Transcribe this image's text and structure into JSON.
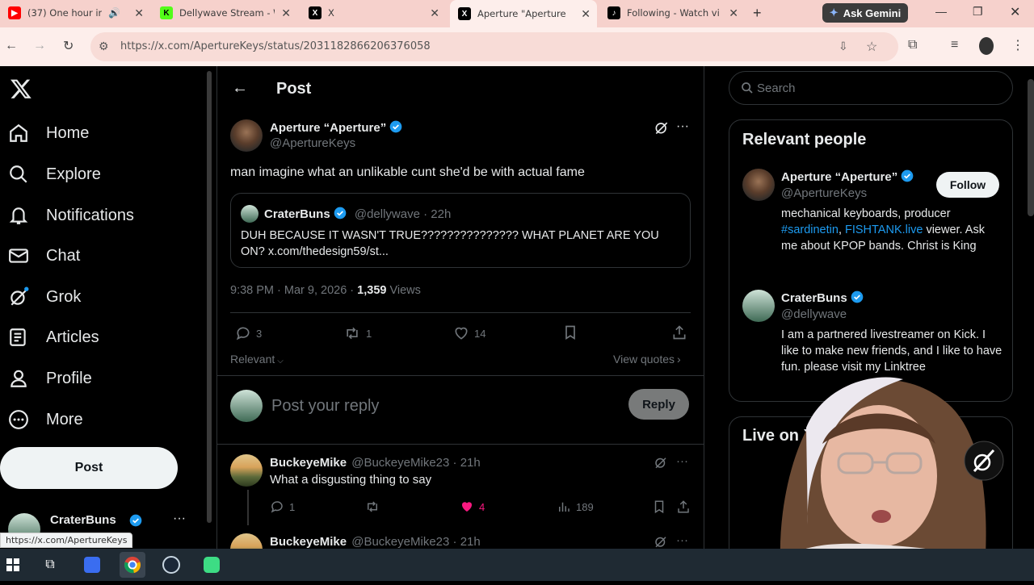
{
  "tabs": [
    {
      "label": "(37) One hour in",
      "color": "#ff0000",
      "glyph": "▶"
    },
    {
      "label": "Dellywave Stream - W",
      "color": "#53fc18",
      "glyph": "K"
    },
    {
      "label": "X",
      "color": "#000000",
      "glyph": "𝕏"
    },
    {
      "label": "Aperture \"Aperture\" o",
      "color": "#000000",
      "glyph": "𝕏"
    },
    {
      "label": "Following - Watch vi",
      "color": "#000000",
      "glyph": "♪"
    }
  ],
  "new_tab_glyph": "+",
  "ask_gemini": "Ask Gemini",
  "url": "https://x.com/ApertureKeys/status/2031182866206376058",
  "nav": {
    "items": [
      {
        "label": "Home",
        "icon": "home-icon"
      },
      {
        "label": "Explore",
        "icon": "search-icon"
      },
      {
        "label": "Notifications",
        "icon": "bell-icon"
      },
      {
        "label": "Chat",
        "icon": "mail-icon"
      },
      {
        "label": "Grok",
        "icon": "grok-icon"
      },
      {
        "label": "Articles",
        "icon": "article-icon"
      },
      {
        "label": "Profile",
        "icon": "person-icon"
      },
      {
        "label": "More",
        "icon": "more-circle-icon"
      }
    ],
    "post_button": "Post",
    "account_name": "CraterBuns"
  },
  "header": {
    "title": "Post"
  },
  "post": {
    "author_name": "Aperture “Aperture”",
    "author_handle": "@ApertureKeys",
    "text": "man imagine what an unlikable cunt she'd be with actual fame",
    "quote": {
      "author_name": "CraterBuns",
      "author_handle": "@dellywave",
      "time": "22h",
      "text": "DUH BECAUSE IT WASN'T TRUE???????????????  WHAT PLANET ARE YOU ON? x.com/thedesign59/st..."
    },
    "timestamp": "9:38 PM · Mar 9, 2026 · ",
    "views_count": "1,359",
    "views_label": " Views",
    "replies": "3",
    "reposts": "1",
    "likes": "14",
    "sort_label": "Relevant",
    "view_quotes": "View quotes"
  },
  "reply_box": {
    "placeholder": "Post your reply",
    "button": "Reply"
  },
  "replies": [
    {
      "name": "BuckeyeMike",
      "handle": "@BuckeyeMike23",
      "time": "21h",
      "text": "What a disgusting thing to say",
      "replies": "1",
      "likes": "4",
      "views": "189"
    },
    {
      "name": "BuckeyeMike",
      "handle": "@BuckeyeMike23",
      "time": "21h"
    }
  ],
  "search": {
    "placeholder": "Search"
  },
  "relevant_people": {
    "title": "Relevant people",
    "people": [
      {
        "name": "Aperture “Aperture”",
        "handle": "@ApertureKeys",
        "follow": "Follow",
        "bio_1": "mechanical keyboards, producer",
        "bio_tag": "#sardinetin",
        "bio_sep": ", ",
        "bio_link": "FISHTANK.live",
        "bio_2": " viewer. Ask me about KPOP bands. Christ is King"
      },
      {
        "name": "CraterBuns",
        "handle": "@dellywave",
        "bio": "I am a partnered livestreamer on Kick. I like to make new friends, and I like to have fun. please visit my Linktree"
      }
    ]
  },
  "live_panel": {
    "title": "Live on X"
  },
  "status_url": "https://x.com/ApertureKeys",
  "colors": {
    "accent": "#1d9bf0",
    "like": "#f91880",
    "tab_bar": "#f6d1cc"
  }
}
